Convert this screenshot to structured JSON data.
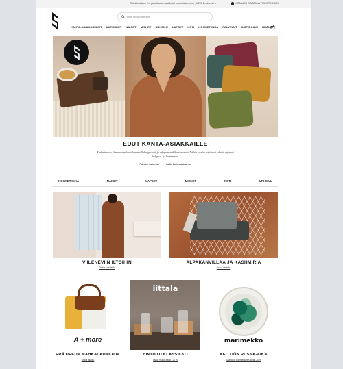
{
  "topbar": {
    "promo": "Toimitusaikuur 2-4 pakettiautomaattiin tai noutopisteeseen, yli 29€ ilmaiseksi! ▸",
    "login_label": "KIRJAUDU SISÄÄN tai REKISTERÖIDY"
  },
  "search": {
    "placeholder": "Hae Stockmannilta"
  },
  "nav": {
    "items": [
      "KANTA-ASIAKASEDUT",
      "UUTUUDET",
      "NAISET",
      "MIEHET",
      "URHEILU",
      "LAPSET",
      "KOTI",
      "KOSMETIIKKA",
      "PALVELUT",
      "INSPIROIDU",
      "BRÄNDIT"
    ]
  },
  "hero": {
    "title": "EDUT KANTA-ASIAKKAILLE",
    "text": "Kashmirneule, lämmin alpakanvillainen villakangastakki ja syksyn muodikkaat asusteet. Näihin kauden kohtiinvat tekevät arjestasi helppoa – ja kaunimpaa.",
    "link1": "Palvelun saatavuus",
    "link2": "Kaikki kanta-asiakasedut"
  },
  "categories": [
    "KOSMETIIKKA",
    "NAISET",
    "LAPSET",
    "MIEHET",
    "KOTI",
    "URHEILU"
  ],
  "features": [
    {
      "title": "VIILENEVIIN ILTOIHIN",
      "link": "Ostoa uusi takki"
    },
    {
      "title": "ALPAKANVILLAA JA KASHMIRIA",
      "link": "Ostoa neuleita"
    }
  ],
  "brands": [
    {
      "wordmark": "A + more",
      "title": "ERÄ UPEITA NAHKALAUKKUJA",
      "link": "Ostoa laukku"
    },
    {
      "wordmark": "iittala",
      "title": "HIMOTTU KLASSIKKO",
      "link": "Iittala Frutta -sarja - 20 %"
    },
    {
      "wordmark": "marimekko",
      "title": "KEITTIÖN RUSKA-AIKA",
      "link": "Sääpäivä Marimekkojen sarja -20 %"
    }
  ],
  "colors": {
    "accent": "#111111",
    "background": "#ffffff",
    "frame": "#dfe3e8"
  }
}
